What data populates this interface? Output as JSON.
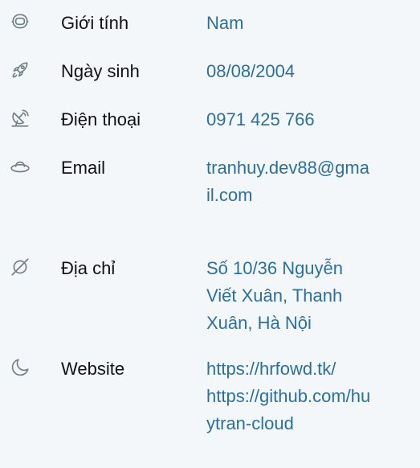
{
  "info": {
    "gender": {
      "label": "Giới tính",
      "value": "Nam",
      "icon": "astronaut-helmet-icon"
    },
    "birthday": {
      "label": "Ngày sinh",
      "value": "08/08/2004",
      "icon": "rocket-icon"
    },
    "phone": {
      "label": "Điện thoại",
      "value": "0971 425 766",
      "icon": "satellite-dish-icon"
    },
    "email": {
      "label": "Email",
      "value": "tranhuy.dev88@gma\nil.com",
      "icon": "ufo-icon"
    },
    "address": {
      "label": "Địa chỉ",
      "value": "Số 10/36 Nguyễn\nViết Xuân, Thanh\nXuân, Hà Nội",
      "icon": "planet-icon"
    },
    "website": {
      "label": "Website",
      "value": "https://hrfowd.tk/\nhttps://github.com/hu\nytran-cloud",
      "icon": "moon-icon"
    }
  },
  "colors": {
    "background": "#f4f7fa",
    "label": "#111111",
    "value": "#2c6f9c",
    "icon": "#6f7d86"
  }
}
